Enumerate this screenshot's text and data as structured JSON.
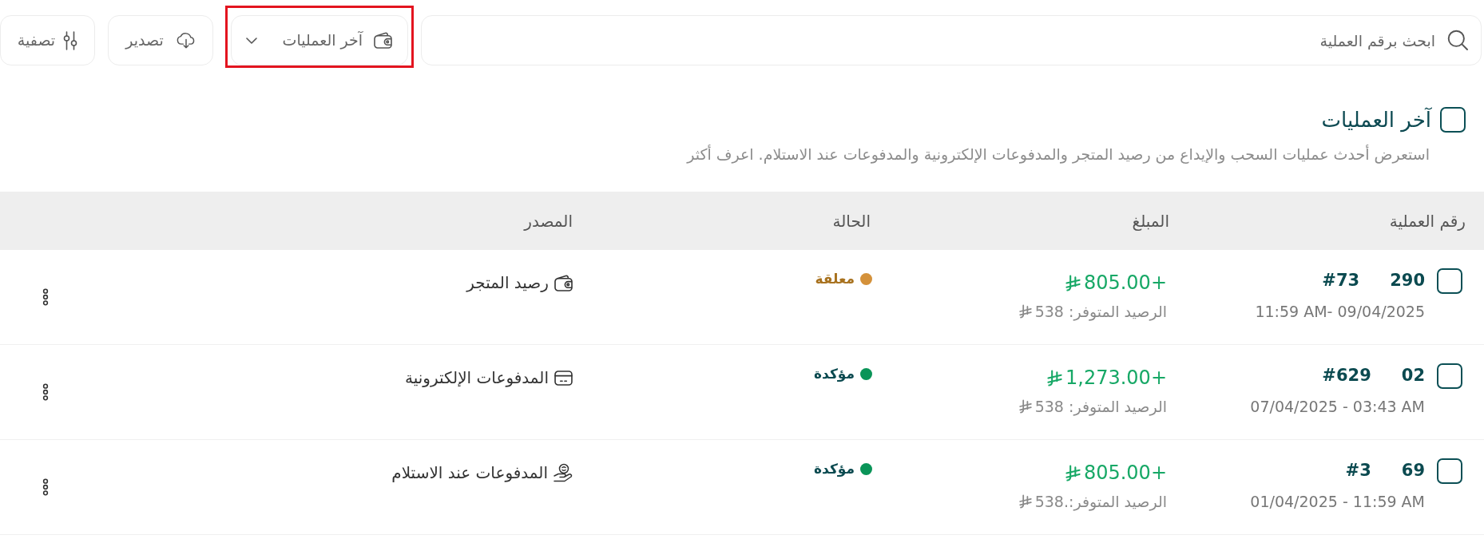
{
  "toolbar": {
    "search": {
      "placeholder": "ابحث برقم العملية"
    },
    "view_dropdown": {
      "label": "آخر العمليات",
      "highlighted": true
    },
    "export_button": {
      "label": "تصدير"
    },
    "filter_button": {
      "label": "تصفية"
    }
  },
  "section": {
    "title": "آخر العمليات",
    "checked": false,
    "description": "استعرض أحدث عمليات السحب والإيداع من رصيد المتجر والمدفوعات الإلكترونية والمدفوعات عند الاستلام. اعرف أكثر"
  },
  "table": {
    "columns": [
      "رقم العملية",
      "المبلغ",
      "الحالة",
      "المصدر"
    ],
    "rows": [
      {
        "checked": false,
        "id_parts": [
          "290",
          "#73"
        ],
        "date": "11:59 AM- 09/04/2025",
        "amount": "+805.00",
        "balance": "الرصيد المتوفر: 538",
        "status": {
          "label": "معلقة",
          "kind": "pending",
          "color": "#d4913a"
        },
        "source": {
          "label": "رصيد المتجر",
          "kind": "wallet"
        }
      },
      {
        "checked": false,
        "id_parts": [
          "02",
          "#629"
        ],
        "date": "07/04/2025 - 03:43 AM",
        "amount": "+1,273.00",
        "balance": "الرصيد المتوفر: 538",
        "status": {
          "label": "مؤكدة",
          "kind": "confirmed",
          "color": "#0a9458"
        },
        "source": {
          "label": "المدفوعات الإلكترونية",
          "kind": "card"
        }
      },
      {
        "checked": false,
        "id_parts": [
          "69",
          "#3"
        ],
        "date": "01/04/2025 - 11:59 AM",
        "amount": "+805.00",
        "balance": "الرصيد المتوفر:.538",
        "status": {
          "label": "مؤكدة",
          "kind": "confirmed",
          "color": "#0a9458"
        },
        "source": {
          "label": "المدفوعات عند الاستلام",
          "kind": "cash"
        }
      }
    ]
  }
}
